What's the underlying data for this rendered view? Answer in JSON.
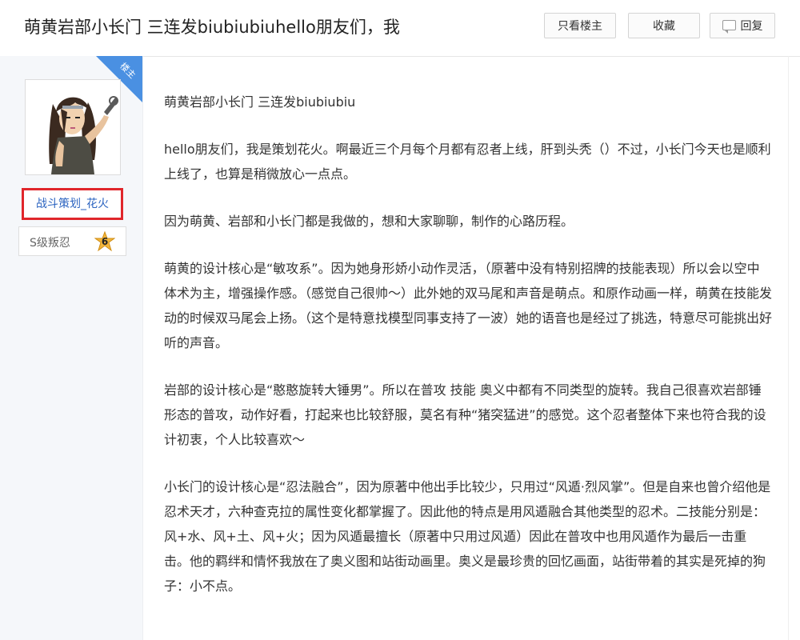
{
  "header": {
    "title": "萌黄岩部小长门 三连发biubiubiuhello朋友们，我",
    "only_author_label": "只看楼主",
    "favorite_label": "收藏",
    "reply_label": "回复"
  },
  "user": {
    "corner_label": "楼主",
    "name": "战斗策划_花火",
    "rank_title": "S级叛忍",
    "rank_level": "6"
  },
  "post": {
    "paragraphs": [
      "萌黄岩部小长门 三连发biubiubiu",
      "hello朋友们，我是策划花火。啊最近三个月每个月都有忍者上线，肝到头秃（）不过，小长门今天也是顺利上线了，也算是稍微放心一点点。",
      "因为萌黄、岩部和小长门都是我做的，想和大家聊聊，制作的心路历程。",
      "萌黄的设计核心是“敏攻系”。因为她身形娇小动作灵活，（原著中没有特别招牌的技能表现）所以会以空中体术为主，增强操作感。（感觉自己很帅～）此外她的双马尾和声音是萌点。和原作动画一样，萌黄在技能发动的时候双马尾会上扬。（这个是特意找模型同事支持了一波）她的语音也是经过了挑选，特意尽可能挑出好听的声音。",
      "岩部的设计核心是“憨憨旋转大锤男”。所以在普攻 技能 奥义中都有不同类型的旋转。我自己很喜欢岩部锤形态的普攻，动作好看，打起来也比较舒服，莫名有种“猪突猛进”的感觉。这个忍者整体下来也符合我的设计初衷，个人比较喜欢～",
      "小长门的设计核心是“忍法融合”，因为原著中他出手比较少，只用过“风遁·烈风掌”。但是自来也曾介绍他是忍术天才，六种查克拉的属性变化都掌握了。因此他的特点是用风遁融合其他类型的忍术。二技能分别是：风+水、风+土、风+火；因为风遁最擅长（原著中只用过风遁）因此在普攻中也用风遁作为最后一击重击。他的羁绊和情怀我放在了奥义图和站街动画里。奥义是最珍贵的回忆画面，站街带着的其实是死掉的狗子：小不点。"
    ]
  },
  "colors": {
    "accent_blue": "#4a90e2",
    "username_link": "#2c64c0",
    "highlight_red": "#e0262b",
    "rank_badge_gold": "#f3b63c"
  }
}
